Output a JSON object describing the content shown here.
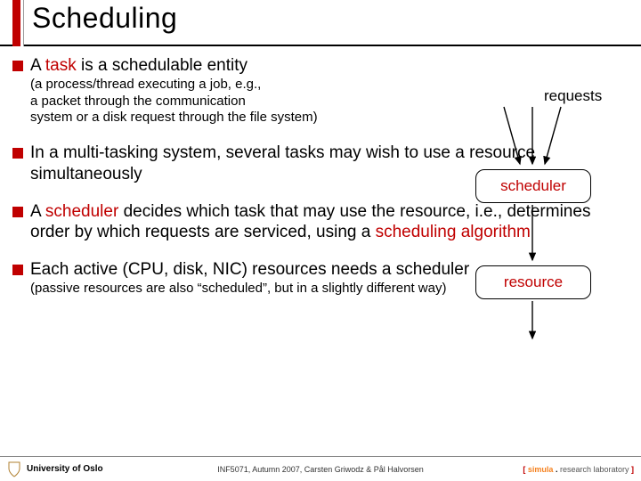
{
  "title": "Scheduling",
  "bullets": {
    "b1": {
      "pre": "A ",
      "kw": "task",
      "post": " is a schedulable entity",
      "sub": "(a process/thread executing a job, e.g.,\na packet through the communication\nsystem or a disk request through the file system)"
    },
    "b2": {
      "main": "In a multi-tasking system, several tasks may wish to use a resource simultaneously"
    },
    "b3": {
      "pre1": "A ",
      "kw1": "scheduler",
      "mid1": " decides which task that may use the resource, i.e., determines order by which requests are serviced, using a ",
      "kw2": "scheduling algorithm"
    },
    "b4": {
      "main": "Each active (CPU, disk, NIC) resources needs a scheduler",
      "sub": "(passive resources are also “scheduled”, but in a slightly different way)"
    }
  },
  "diagram": {
    "requests": "requests",
    "scheduler": "scheduler",
    "resource": "resource"
  },
  "footer": {
    "left": "University of Oslo",
    "mid": "INF5071, Autumn 2007, Carsten Griwodz & Pål Halvorsen",
    "right_sim": "simula",
    "right_rest": "research laboratory"
  }
}
